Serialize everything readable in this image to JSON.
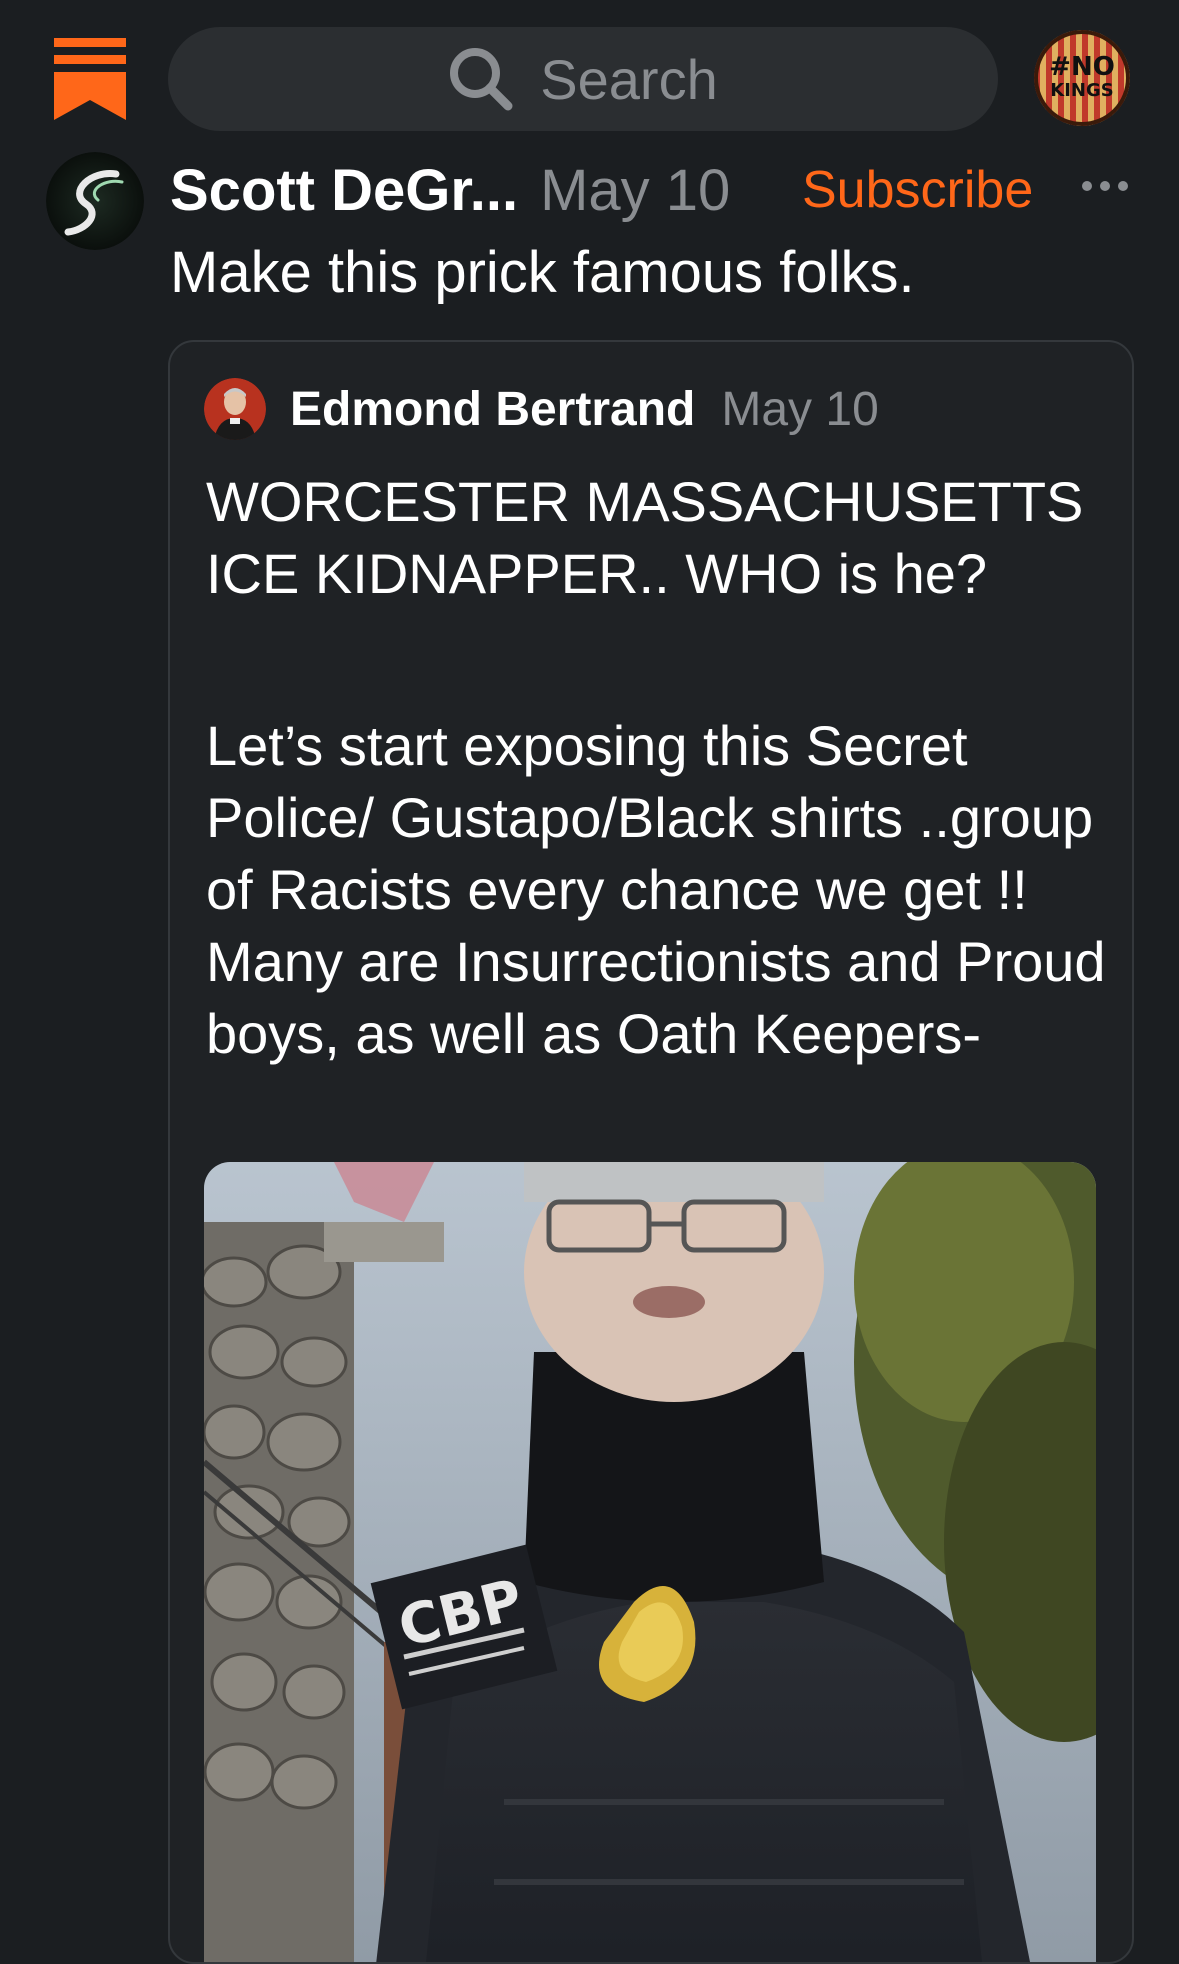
{
  "header": {
    "logo_icon": "substack-bookmark-icon",
    "search": {
      "placeholder": "Search",
      "icon": "search-icon"
    },
    "profile": {
      "badge_line1": "#NO",
      "badge_line2": "KINGS"
    }
  },
  "post": {
    "author": "Scott DeGr...",
    "date": "May 10",
    "subscribe_label": "Subscribe",
    "more_icon": "more-icon",
    "text": "Make this prick famous folks.",
    "quote": {
      "author": "Edmond Bertrand",
      "date": "May 10",
      "title": "WORCESTER MASSACHUSETTS ICE KIDNAPPER.. WHO is he?",
      "body": "Let’s start exposing this Secret Police/ Gustapo/Black shirts ..group of Racists every chance we get !! Many are Insurrectionists and Proud boys, as well as Oath Keepers-",
      "image": {
        "patch_text": "CBP"
      }
    }
  },
  "colors": {
    "background": "#1b1e21",
    "accent": "#ff6719",
    "muted": "#8a8d91"
  }
}
